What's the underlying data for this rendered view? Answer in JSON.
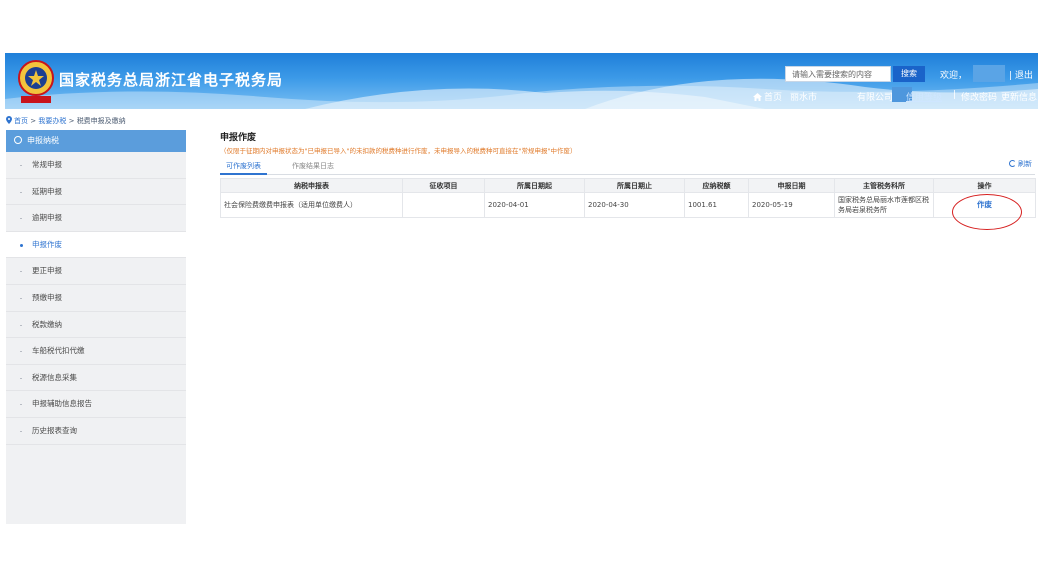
{
  "header": {
    "title": "国家税务总局浙江省电子税务局",
    "emblem_text": "中国税务",
    "search_placeholder": "请输入需要搜索的内容",
    "search_button": "搜索",
    "welcome": "欢迎，",
    "logout": "退出",
    "home": "首页",
    "city": "丽水市",
    "company": "有限公司",
    "credit_rating": "信用等级",
    "separator": "|",
    "change_password": "修改密码",
    "update_info": "更新信息"
  },
  "breadcrumb": {
    "home": "首页",
    "sep1": ">",
    "level1": "我要办税",
    "sep2": ">",
    "level2": "税费申报及缴纳"
  },
  "sidebar": {
    "header": "申报纳税",
    "items": [
      {
        "label": "常规申报"
      },
      {
        "label": "延期申报"
      },
      {
        "label": "逾期申报"
      },
      {
        "label": "申报作废"
      },
      {
        "label": "更正申报"
      },
      {
        "label": "预缴申报"
      },
      {
        "label": "税款缴纳"
      },
      {
        "label": "车船税代扣代缴"
      },
      {
        "label": "税源信息采集"
      },
      {
        "label": "申报辅助信息报告"
      },
      {
        "label": "历史报表查询"
      }
    ],
    "active_index": 3
  },
  "main": {
    "title": "申报作废",
    "note": "（仅限于征期内对申报状态为\"已申报已导入\"的未扣款的税费种进行作废，未申报导入的税费种可直接在\"常规申报\"中作废）",
    "tabs": [
      "可作废列表",
      "作废结果日志"
    ],
    "refresh": "刷新",
    "table": {
      "headers": [
        "纳税申报表",
        "征收项目",
        "所属日期起",
        "所属日期止",
        "应纳税额",
        "申报日期",
        "主管税务科所",
        "操作"
      ],
      "rows": [
        {
          "form": "社会保险费缴费申报表（适用单位缴费人）",
          "item": "",
          "date_from": "2020-04-01",
          "date_to": "2020-04-30",
          "tax": "1001.61",
          "declare_date": "2020-05-19",
          "office": "国家税务总局丽水市莲都区税务局岩泉税务所",
          "action": "作废"
        }
      ]
    }
  },
  "colors": {
    "banner": "#2a86dc",
    "accent": "#2f74d0",
    "note": "#e07a2a",
    "annotation": "#d62020"
  }
}
